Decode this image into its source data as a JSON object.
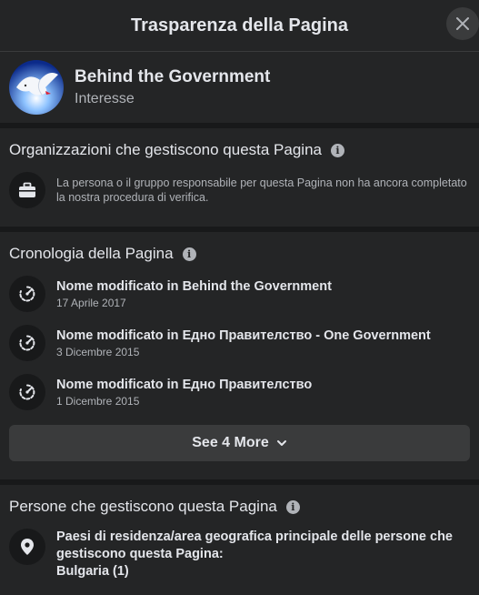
{
  "header": {
    "title": "Trasparenza della Pagina"
  },
  "page": {
    "name": "Behind the Government",
    "category": "Interesse"
  },
  "organizations": {
    "title": "Organizzazioni che gestiscono questa Pagina",
    "text": "La persona o il gruppo responsabile per questa Pagina non ha ancora completato la nostra procedura di verifica."
  },
  "history": {
    "title": "Cronologia della Pagina",
    "items": [
      {
        "title": "Nome modificato in Behind the Government",
        "date": "17 Aprile 2017"
      },
      {
        "title": "Nome modificato in Едно Правителство - One Government",
        "date": "3 Dicembre 2015"
      },
      {
        "title": "Nome modificato in Едно Правителство",
        "date": "1 Dicembre 2015"
      }
    ],
    "see_more_label": "See 4 More"
  },
  "people": {
    "title": "Persone che gestiscono questa Pagina",
    "location_label": "Paesi di residenza/area geografica principale delle persone che gestiscono questa Pagina:",
    "location_value": "Bulgaria (1)"
  },
  "icons": {
    "close": "close-icon",
    "info": "info-icon",
    "briefcase": "briefcase-icon",
    "history": "history-icon",
    "location": "location-pin-icon",
    "chevron": "chevron-down-icon"
  },
  "colors": {
    "background": "#242526",
    "divider": "#18191a",
    "button": "#3a3b3c",
    "text": "#e4e6eb",
    "secondary": "#b0b3b8"
  }
}
